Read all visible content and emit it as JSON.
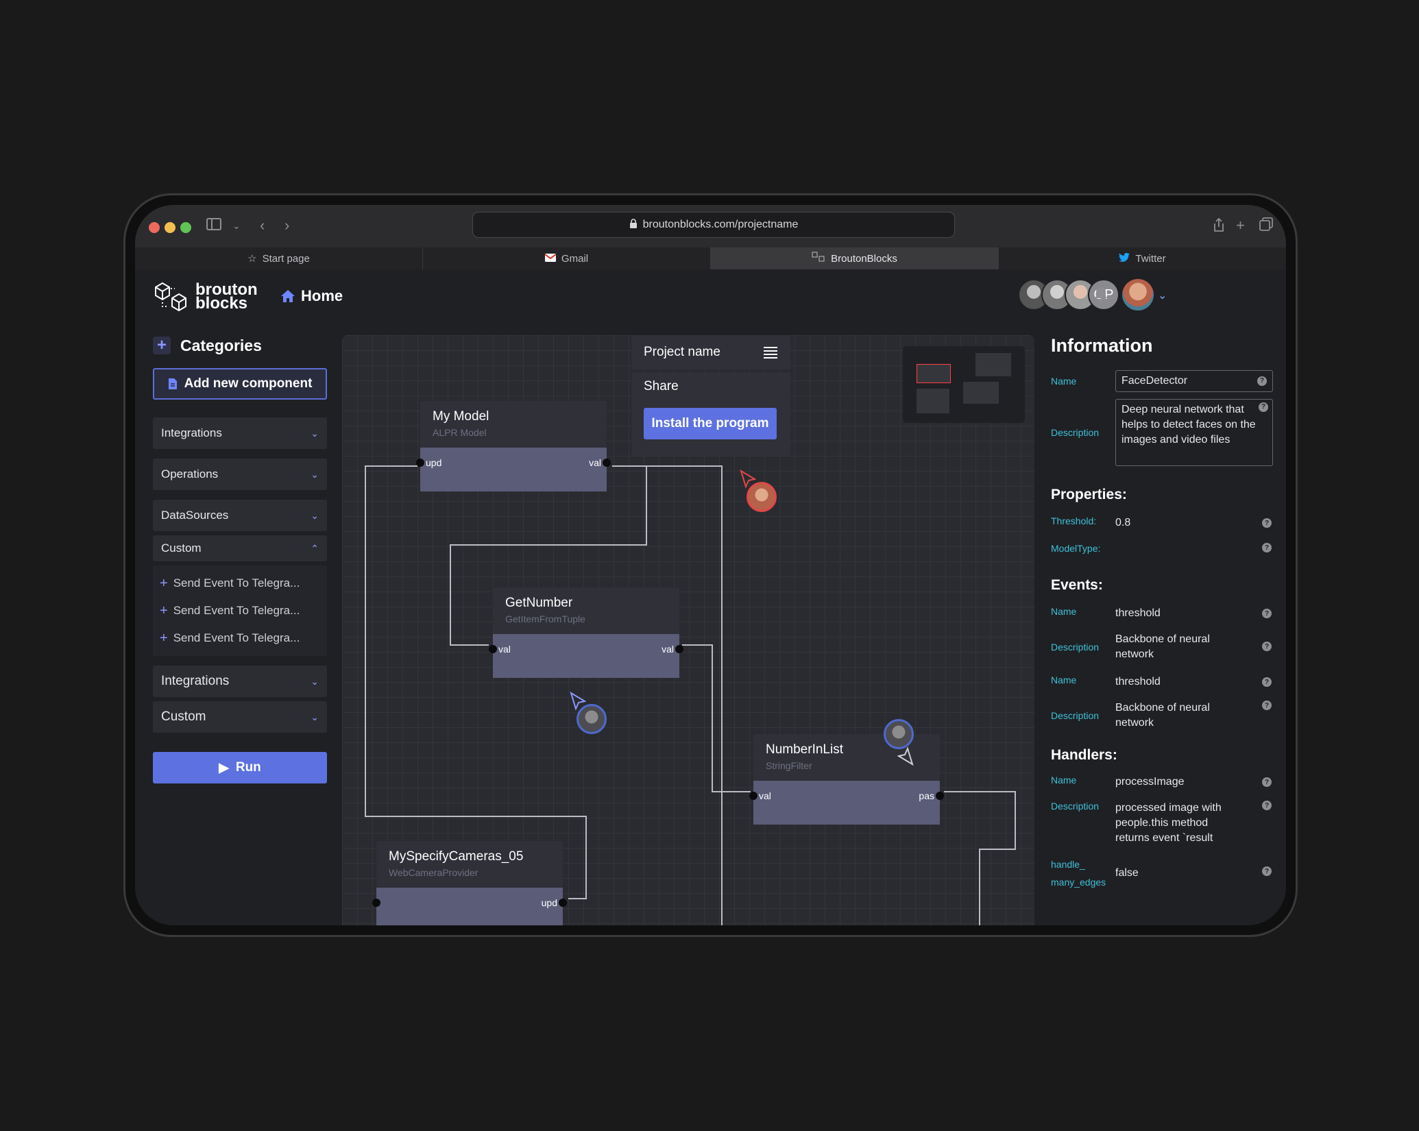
{
  "browser": {
    "url": "broutonblocks.com/projectname",
    "tabs": [
      {
        "label": "Start page",
        "icon": "star-icon"
      },
      {
        "label": "Gmail",
        "icon": "gmail-icon"
      },
      {
        "label": "BroutonBlocks",
        "icon": "brouton-icon"
      },
      {
        "label": "Twitter",
        "icon": "twitter-icon"
      }
    ],
    "active_tab": 2
  },
  "header": {
    "logo_line1": "brouton",
    "logo_line2": "blocks",
    "home_label": "Home",
    "collaborator_initials": "OP"
  },
  "sidebar": {
    "title": "Categories",
    "add_button": "Add new component",
    "sections": [
      {
        "label": "Integrations"
      },
      {
        "label": "Operations"
      },
      {
        "label": "DataSources"
      },
      {
        "label": "Custom",
        "expanded": true
      }
    ],
    "custom_items": [
      "Send Event To Telegra...",
      "Send Event To Telegra...",
      "Send Event To Telegra..."
    ],
    "sections_after": [
      {
        "label": "Integrations"
      },
      {
        "label": "Custom"
      }
    ],
    "run_button": "Run"
  },
  "canvas": {
    "project_name": "Project name",
    "share_label": "Share",
    "install_button": "Install the program",
    "nodes": [
      {
        "title": "My Model",
        "subtitle": "ALPR Model",
        "in_port": "upd",
        "out_port": "val"
      },
      {
        "title": "GetNumber",
        "subtitle": "GetItemFromTuple",
        "in_port": "val",
        "out_port": "val"
      },
      {
        "title": "NumberInList",
        "subtitle": "StringFilter",
        "in_port": "val",
        "out_port": "pas"
      },
      {
        "title": "MySpecifyCameras_05",
        "subtitle": "WebCameraProvider",
        "in_port": "",
        "out_port": "upd"
      }
    ]
  },
  "info": {
    "title": "Information",
    "name_label": "Name",
    "name_value": "FaceDetector",
    "description_label": "Description",
    "description_value": "Deep neural network that helps to detect faces on the images and video files",
    "properties_title": "Properties:",
    "properties": [
      {
        "label": "Threshold:",
        "value": "0.8"
      },
      {
        "label": "ModelType:",
        "value": ""
      }
    ],
    "events_title": "Events:",
    "events": [
      {
        "label": "Name",
        "value": "threshold"
      },
      {
        "label": "Description",
        "value": "Backbone of neural network"
      },
      {
        "label": "Name",
        "value": "threshold"
      },
      {
        "label": "Description",
        "value": "Backbone of neural network"
      }
    ],
    "handlers_title": "Handlers:",
    "handlers": [
      {
        "label": "Name",
        "value": "processImage"
      },
      {
        "label": "Description",
        "value": "processed image with people.this method returns event `result"
      },
      {
        "label": "handle_ many_edges",
        "value": "false"
      }
    ]
  },
  "colors": {
    "accent": "#5d72e0",
    "label_cyan": "#3fc0d8",
    "node_body": "#5a5c78"
  }
}
